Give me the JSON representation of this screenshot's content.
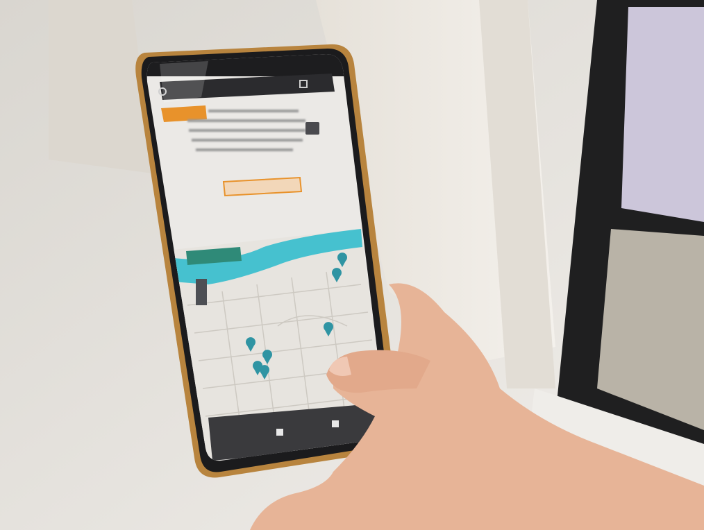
{
  "scene": {
    "description_tags": [
      "street",
      "phone-in-hand",
      "map-website"
    ],
    "colors": {
      "wall": "#ece8e1",
      "sidewalk": "#e9e6e1",
      "phone_frame": "#b8843e",
      "map_water": "#46c1cf",
      "map_land": "#e7e4df",
      "map_pin": "#2f94a3",
      "badge_orange": "#e8922b",
      "badge_green": "#2f8a78",
      "skin": "#e7b497"
    }
  },
  "phone": {
    "status_time": "",
    "url_text": "",
    "intro_text": "",
    "cta_label": "",
    "map_section_badge": "",
    "nav_left_label": "",
    "nav_right_label": "",
    "pin_count": 7
  }
}
